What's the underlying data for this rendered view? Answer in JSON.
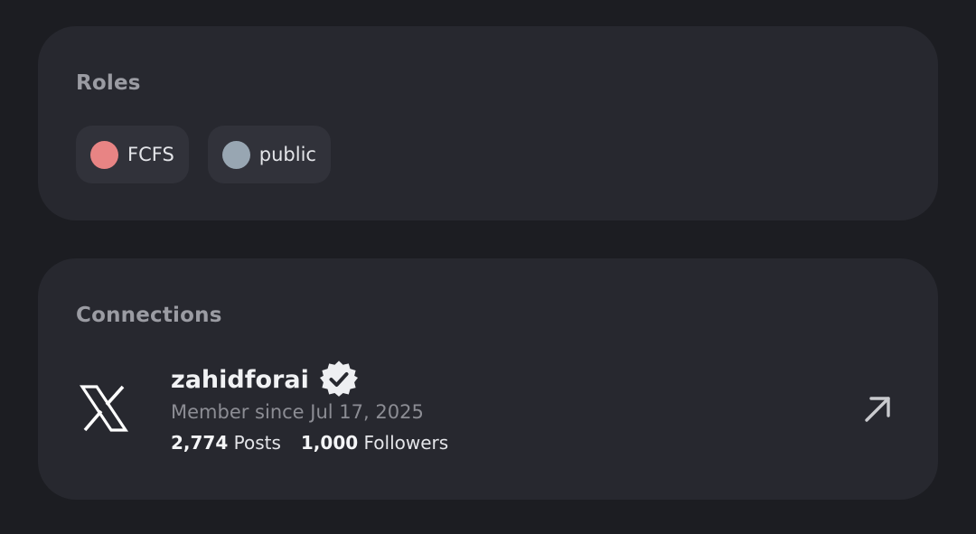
{
  "roles": {
    "title": "Roles",
    "items": [
      {
        "label": "FCFS",
        "color": "#e88484"
      },
      {
        "label": "public",
        "color": "#98a6b2"
      }
    ]
  },
  "connections": {
    "title": "Connections",
    "items": [
      {
        "service_icon": "x-logo-icon",
        "username": "zahidforai",
        "verified": true,
        "member_since": "Member since Jul 17, 2025",
        "posts_count": "2,774",
        "posts_label": "Posts",
        "followers_count": "1,000",
        "followers_label": "Followers",
        "action_icon": "external-link-arrow-icon"
      }
    ]
  }
}
